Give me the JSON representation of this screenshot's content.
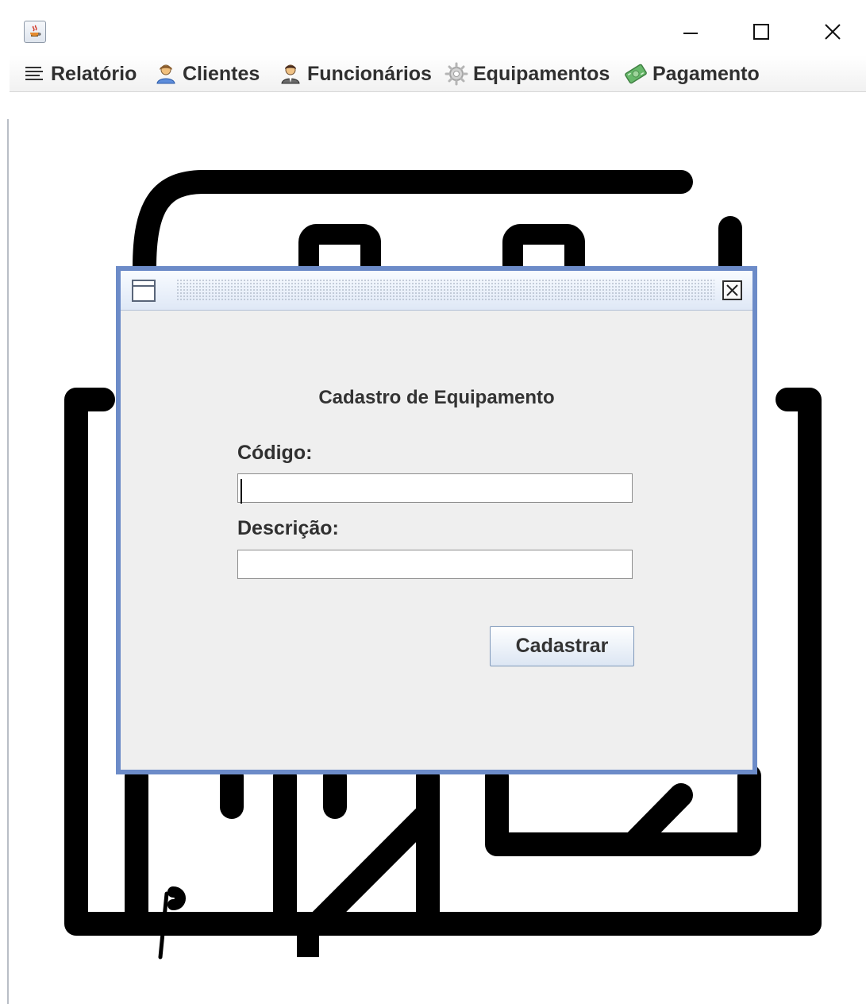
{
  "window": {
    "title": "",
    "controls": [
      "minimize-icon",
      "maximize-icon",
      "close-icon"
    ]
  },
  "menu": {
    "items": [
      {
        "label": "Relatório",
        "icon": "list-icon"
      },
      {
        "label": "Clientes",
        "icon": "user-icon"
      },
      {
        "label": "Funcionários",
        "icon": "employee-icon"
      },
      {
        "label": "Equipamentos",
        "icon": "gear-icon"
      },
      {
        "label": "Pagamento",
        "icon": "money-icon"
      }
    ]
  },
  "dialog": {
    "title": "Cadastro de Equipamento",
    "fields": [
      {
        "label": "Código:",
        "value": ""
      },
      {
        "label": "Descrição:",
        "value": ""
      }
    ],
    "submit_label": "Cadastrar"
  },
  "colors": {
    "dialog_border": "#6c8bc8",
    "dialog_background": "#efefef",
    "text": "#303030",
    "background_art": "#000000"
  }
}
